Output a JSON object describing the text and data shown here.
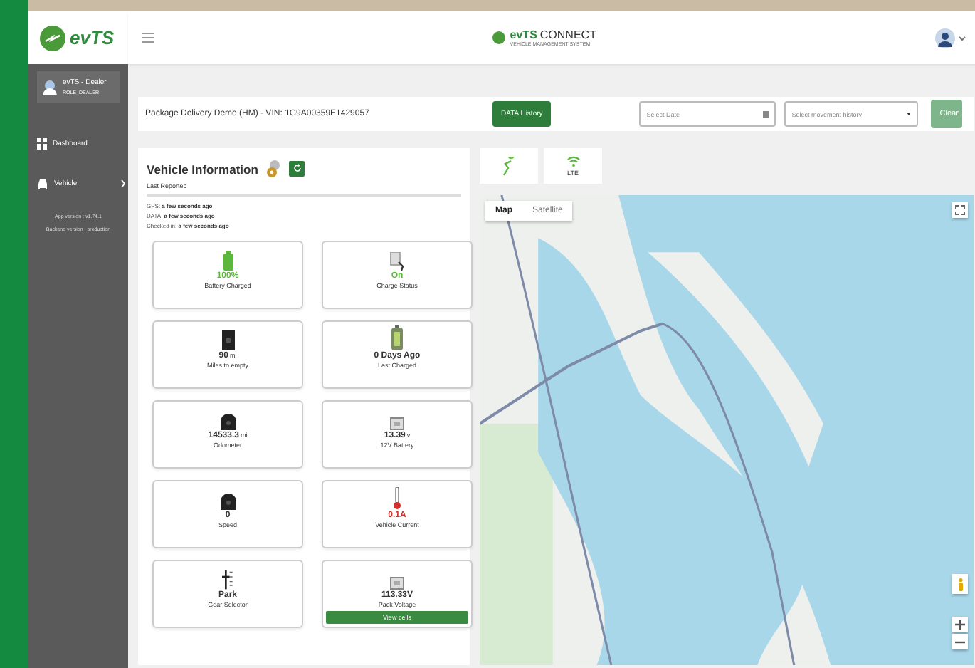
{
  "brand": {
    "logo_text": "evTS",
    "center_logo": "evTS",
    "center_logo_suffix": "CONNECT",
    "center_subtitle": "VEHICLE MANAGEMENT SYSTEM"
  },
  "user": {
    "name": "evTS - Dealer",
    "role": "ROLE_DEALER"
  },
  "sidebar": {
    "items": [
      {
        "label": "Dashboard",
        "kind": "dashboard",
        "has_arrow": false
      },
      {
        "label": "Vehicle",
        "kind": "vehicle",
        "has_arrow": true
      }
    ],
    "app_version": "App version : v1.74.1",
    "backend_version": "Backend version : production"
  },
  "toolbar": {
    "vehicle_title": "Package Delivery Demo (HM) - VIN: 1G9A00359E1429057",
    "history_button": "DATA History",
    "date_field": {
      "placeholder": "Select Date"
    },
    "movement_select": {
      "placeholder": "Select movement history"
    },
    "clear_button": "Clear"
  },
  "status_tiles": [
    {
      "kind": "gps"
    },
    {
      "kind": "signal",
      "label": "LTE"
    }
  ],
  "vehicle_info": {
    "title": "Vehicle Information",
    "subtitle": "Last Reported",
    "reports": [
      {
        "label": "GPS:",
        "value": "a few seconds ago"
      },
      {
        "label": "DATA:",
        "value": "a few seconds ago"
      },
      {
        "label": "Checked in:",
        "value": "a few seconds ago"
      }
    ],
    "tiles": [
      {
        "kind": "battery",
        "value": "100%",
        "label": "Battery Charged",
        "color": "#5cb83c"
      },
      {
        "kind": "charger",
        "value": "On",
        "label": "Charge Status",
        "color": "#5cb83c"
      },
      {
        "kind": "fuel",
        "value": "90",
        "unit": "mi",
        "label": "Miles to empty",
        "color": "#333333"
      },
      {
        "kind": "battery-cell",
        "value": "0 Days Ago",
        "label": "Last Charged",
        "color": "#333333"
      },
      {
        "kind": "gauge",
        "value": "14533.3",
        "unit": "mi",
        "label": "Odometer",
        "color": "#333333"
      },
      {
        "kind": "box",
        "value": "13.39",
        "unit": "v",
        "label": "12V Battery",
        "color": "#333333"
      },
      {
        "kind": "gauge",
        "value": "0",
        "label": "Speed",
        "color": "#333333"
      },
      {
        "kind": "thermo",
        "value": "0.1A",
        "label": "Vehicle Current",
        "color": "#d2312b"
      },
      {
        "kind": "gear",
        "value": "Park",
        "label": "Gear Selector",
        "color": "#333333"
      },
      {
        "kind": "box",
        "value": "113.33V",
        "label": "Pack Voltage",
        "color": "#333333",
        "button": "View cells"
      }
    ]
  },
  "map": {
    "tabs": [
      {
        "label": "Map",
        "selected": true
      },
      {
        "label": "Satellite",
        "selected": false
      }
    ]
  }
}
